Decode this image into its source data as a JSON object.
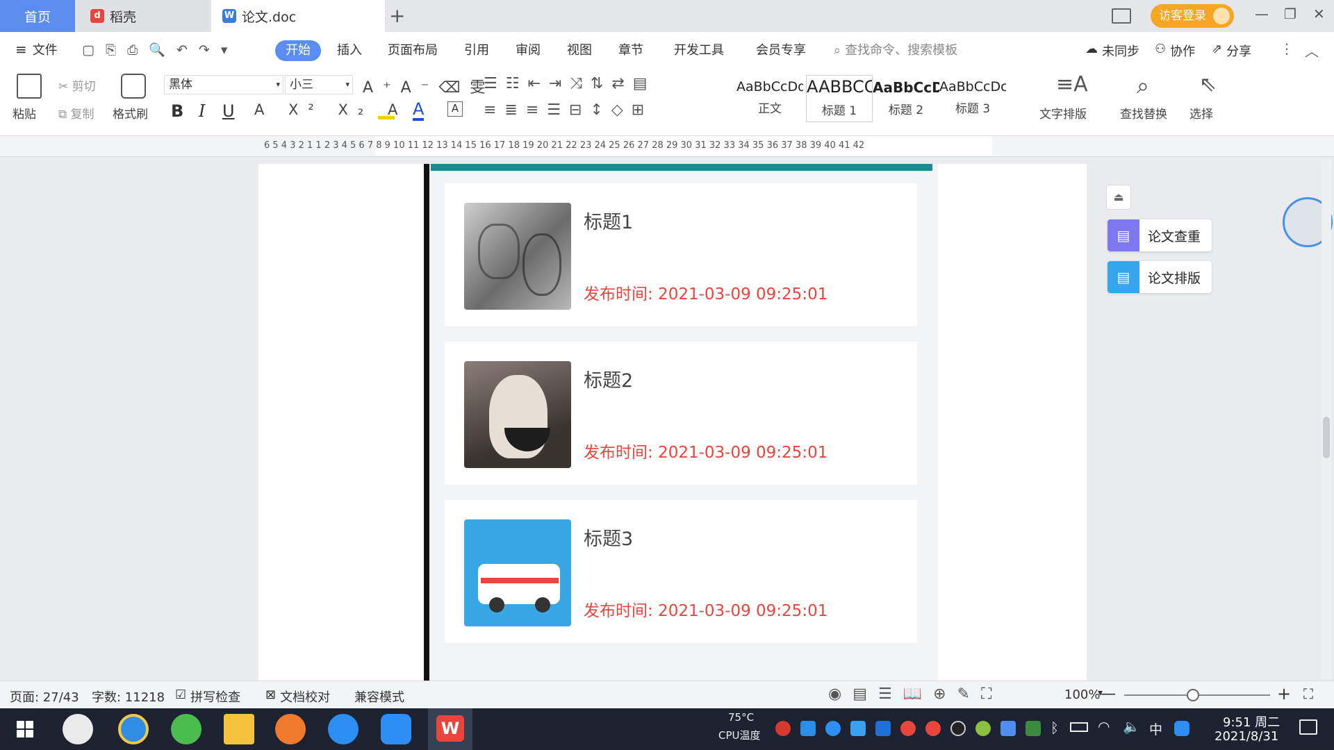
{
  "tabs": {
    "home": "首页",
    "daoke": "稻壳",
    "doc": "论文.doc",
    "new_tab": "+"
  },
  "title_right": {
    "login": "访客登录",
    "minimize": "—",
    "restore": "❐",
    "close": "✕"
  },
  "ribbon": {
    "file": "文件",
    "tabs": [
      "开始",
      "插入",
      "页面布局",
      "引用",
      "审阅",
      "视图",
      "章节",
      "开发工具",
      "会员专享"
    ],
    "search_placeholder": "查找命令、搜索模板",
    "sync": "未同步",
    "collab": "协作",
    "share": "分享"
  },
  "toolbar": {
    "paste": "粘贴",
    "cut": "剪切",
    "copy": "复制",
    "format_painter": "格式刷",
    "font_name": "黑体",
    "font_size": "小三",
    "bold": "B",
    "italic": "I",
    "underline": "U",
    "styles": [
      {
        "preview": "AaBbCcDd",
        "label": "正文"
      },
      {
        "preview": "AABBCC",
        "label": "标题 1"
      },
      {
        "preview": "AaBbCcD",
        "label": "标题 2"
      },
      {
        "preview": "AaBbCcDc",
        "label": "标题 3"
      }
    ],
    "text_layout": "文字排版",
    "find_replace": "查找替换",
    "select": "选择"
  },
  "ruler": {
    "numbers": "6   5   4   3   2   1       1   2   3   4   5   6   7   8   9  10  11  12  13  14  15  16  17  18  19  20  21  22  23  24  25  26  27  28  29  30  31  32  33  34  35  36  37  38  39  40  41  42"
  },
  "cards": [
    {
      "title": "标题1",
      "time": "发布时间:  2021-03-09 09:25:01"
    },
    {
      "title": "标题2",
      "time": "发布时间:  2021-03-09 09:25:01"
    },
    {
      "title": "标题3",
      "time": "发布时间:  2021-03-09 09:25:01"
    }
  ],
  "side_panel": {
    "check": "论文查重",
    "layout": "论文排版"
  },
  "status": {
    "page": "页面: 27/43",
    "words": "字数: 11218",
    "spell": "拼写检查",
    "proof": "文档校对",
    "compat": "兼容模式",
    "zoom": "100%",
    "zoom_out": "—",
    "zoom_in": "+"
  },
  "taskbar": {
    "cpu_temp": "75°C",
    "cpu_label": "CPU温度",
    "ime": "中",
    "time": "9:51 周二",
    "date": "2021/8/31"
  },
  "colors": {
    "accent": "#5b8def",
    "teal_bar": "#1f8a92",
    "time_red": "#e8453c",
    "login_orange": "#f5a623"
  }
}
